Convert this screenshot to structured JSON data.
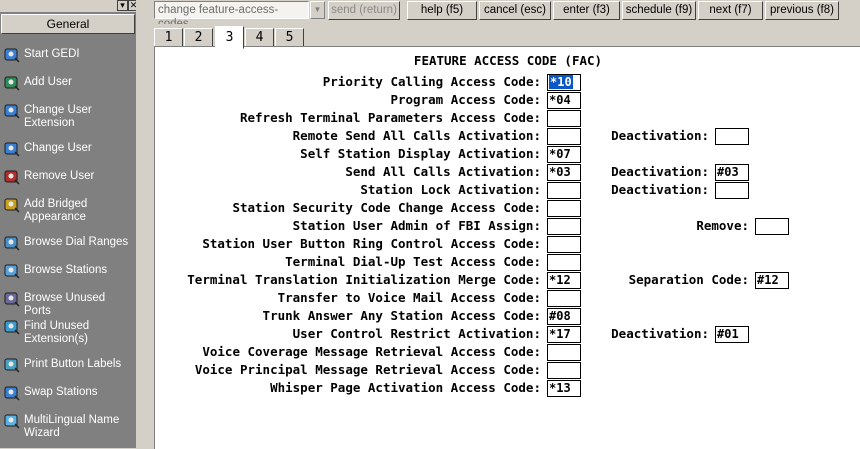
{
  "sidebar": {
    "header": "General",
    "items": [
      {
        "label": "Start GEDI",
        "icon": "start-gedi-icon"
      },
      {
        "label": "Add User",
        "icon": "add-user-icon"
      },
      {
        "label": "Change User Extension",
        "icon": "change-extension-icon"
      },
      {
        "label": "Change User",
        "icon": "change-user-icon"
      },
      {
        "label": "Remove User",
        "icon": "remove-user-icon"
      },
      {
        "label": "Add Bridged Appearance",
        "icon": "bridged-appearance-icon"
      },
      {
        "label": "Browse Dial Ranges",
        "icon": "dial-ranges-icon"
      },
      {
        "label": "Browse Stations",
        "icon": "stations-icon"
      },
      {
        "label": "Browse Unused Ports",
        "icon": "unused-ports-icon"
      },
      {
        "label": "Find Unused Extension(s)",
        "icon": "find-extension-icon"
      },
      {
        "label": "Print Button Labels",
        "icon": "print-labels-icon"
      },
      {
        "label": "Swap Stations",
        "icon": "swap-stations-icon"
      },
      {
        "label": "MultiLingual Name Wizard",
        "icon": "name-wizard-icon"
      }
    ]
  },
  "toolbar": {
    "command_value": "change feature-access-codes",
    "send": "send (return)",
    "help": "help (f5)",
    "cancel": "cancel (esc)",
    "enter": "enter (f3)",
    "schedule": "schedule (f9)",
    "next": "next (f7)",
    "previous": "previous (f8)"
  },
  "tabs": [
    "1",
    "2",
    "3",
    "4",
    "5"
  ],
  "active_tab": "3",
  "form": {
    "title": "FEATURE ACCESS CODE (FAC)",
    "rows": [
      {
        "label": "Priority Calling Access Code:",
        "value": "*10",
        "selected": true
      },
      {
        "label": "Program Access Code:",
        "value": "*04"
      },
      {
        "label": "Refresh Terminal Parameters Access Code:",
        "value": ""
      },
      {
        "label": "Remote Send All Calls Activation:",
        "value": "",
        "label2": "Deactivation:",
        "value2": ""
      },
      {
        "label": "Self Station Display Activation:",
        "value": "*07"
      },
      {
        "label": "Send All Calls Activation:",
        "value": "*03",
        "label2": "Deactivation:",
        "value2": "#03"
      },
      {
        "label": "Station Lock Activation:",
        "value": "",
        "label2": "Deactivation:",
        "value2": ""
      },
      {
        "label": "Station Security Code Change Access Code:",
        "value": ""
      },
      {
        "label": "Station User Admin of FBI Assign:",
        "value": "",
        "label2": "Remove:",
        "value2": ""
      },
      {
        "label": "Station User Button Ring Control Access Code:",
        "value": ""
      },
      {
        "label": "Terminal Dial-Up Test Access Code:",
        "value": ""
      },
      {
        "label": "Terminal Translation Initialization Merge Code:",
        "value": "*12",
        "label2": "Separation Code:",
        "value2": "#12"
      },
      {
        "label": "Transfer to Voice Mail Access Code:",
        "value": ""
      },
      {
        "label": "Trunk Answer Any Station Access Code:",
        "value": "#08"
      },
      {
        "label": "User Control Restrict Activation:",
        "value": "*17",
        "label2": "Deactivation:",
        "value2": "#01"
      },
      {
        "label": "Voice Coverage Message Retrieval Access Code:",
        "value": ""
      },
      {
        "label": "Voice Principal Message Retrieval Access Code:",
        "value": ""
      },
      {
        "label": "Whisper Page Activation Access Code:",
        "value": "*13"
      }
    ]
  }
}
